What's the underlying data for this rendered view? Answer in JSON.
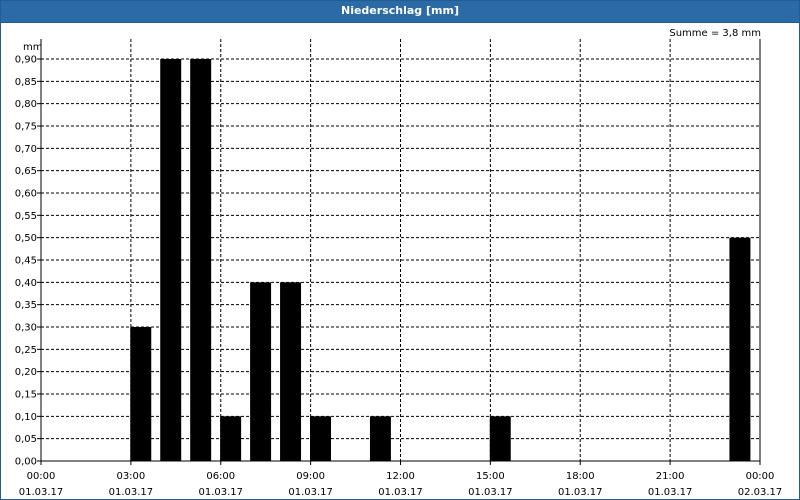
{
  "window": {
    "title": "Niederschlag [mm]"
  },
  "chart_data": {
    "type": "bar",
    "unit": "mm",
    "sum_text": "Summe = 3,8 mm",
    "y_ticks": [
      "0,00",
      "0,05",
      "0,10",
      "0,15",
      "0,20",
      "0,25",
      "0,30",
      "0,35",
      "0,40",
      "0,45",
      "0,50",
      "0,55",
      "0,60",
      "0,65",
      "0,70",
      "0,75",
      "0,80",
      "0,85",
      "0,90"
    ],
    "ylim": [
      0,
      0.9
    ],
    "x_ticks": [
      {
        "time": "00:00",
        "date": "01.03.17"
      },
      {
        "time": "03:00",
        "date": "01.03.17"
      },
      {
        "time": "06:00",
        "date": "01.03.17"
      },
      {
        "time": "09:00",
        "date": "01.03.17"
      },
      {
        "time": "12:00",
        "date": "01.03.17"
      },
      {
        "time": "15:00",
        "date": "01.03.17"
      },
      {
        "time": "18:00",
        "date": "01.03.17"
      },
      {
        "time": "21:00",
        "date": "01.03.17"
      },
      {
        "time": "00:00",
        "date": "02.03.17"
      }
    ],
    "xlim_hours": [
      0,
      24
    ],
    "bars": [
      {
        "hour": 3.33,
        "value": 0.3
      },
      {
        "hour": 4.33,
        "value": 0.9
      },
      {
        "hour": 5.33,
        "value": 0.9
      },
      {
        "hour": 6.33,
        "value": 0.1
      },
      {
        "hour": 7.33,
        "value": 0.4
      },
      {
        "hour": 8.33,
        "value": 0.4
      },
      {
        "hour": 9.33,
        "value": 0.1
      },
      {
        "hour": 11.33,
        "value": 0.1
      },
      {
        "hour": 15.33,
        "value": 0.1
      },
      {
        "hour": 23.33,
        "value": 0.5
      }
    ],
    "bar_color": "#000000",
    "grid": true
  }
}
